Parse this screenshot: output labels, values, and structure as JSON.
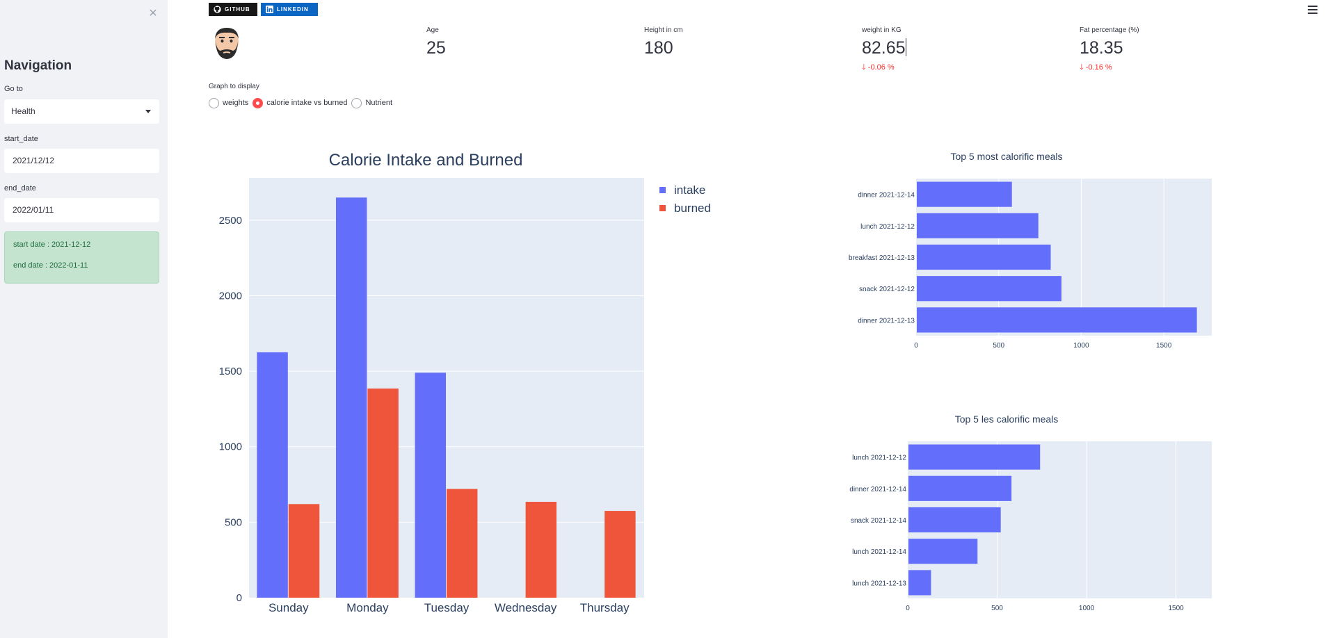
{
  "sidebar": {
    "close_icon": "close-icon",
    "title": "Navigation",
    "goto_label": "Go to",
    "goto_value": "Health",
    "start_label": "start_date",
    "start_value": "2021/12/12",
    "end_label": "end_date",
    "end_value": "2022/01/11",
    "info_start": "start date : 2021-12-12",
    "info_end": "end date : 2022-01-11"
  },
  "badges": {
    "github": "GITHUB",
    "linkedin": "LINKEDIN",
    "github_color": "#181717",
    "linkedin_color": "#0a66c2"
  },
  "metrics": [
    {
      "label": "Age",
      "value": "25",
      "delta": ""
    },
    {
      "label": "Height in cm",
      "value": "180",
      "delta": ""
    },
    {
      "label": "weight in KG",
      "value": "82.65",
      "delta": "-0.06 %"
    },
    {
      "label": "Fat percentage (%)",
      "value": "18.35",
      "delta": "-0.16 %"
    }
  ],
  "graph_select": {
    "label": "Graph to display",
    "options": [
      "weights",
      "calorie intake vs burned",
      "Nutrient"
    ],
    "selected": "calorie intake vs burned"
  },
  "colors": {
    "intake": "#636efa",
    "burned": "#ef553b",
    "plot_bg": "#e5ecf6",
    "accent": "#ff4b4b"
  },
  "chart_data": [
    {
      "type": "bar",
      "title": "Calorie Intake and Burned",
      "categories": [
        "Sunday",
        "Monday",
        "Tuesday",
        "Wednesday",
        "Thursday"
      ],
      "series": [
        {
          "name": "intake",
          "values": [
            1625,
            2650,
            1490,
            0,
            0
          ]
        },
        {
          "name": "burned",
          "values": [
            620,
            1385,
            720,
            635,
            575
          ]
        }
      ],
      "ylim": [
        0,
        2780
      ],
      "yticks": [
        0,
        500,
        1000,
        1500,
        2000,
        2500
      ],
      "grid": true,
      "legend": "right"
    },
    {
      "type": "bar",
      "orientation": "horizontal",
      "title": "Top 5 most calorific meals",
      "categories": [
        "dinner 2021-12-14",
        "lunch 2021-12-12",
        "breakfast 2021-12-13",
        "snack 2021-12-12",
        "dinner 2021-12-13"
      ],
      "values": [
        580,
        740,
        815,
        880,
        1700
      ],
      "xlim": [
        0,
        1790
      ],
      "xticks": [
        0,
        500,
        1000,
        1500
      ],
      "grid": true
    },
    {
      "type": "bar",
      "orientation": "horizontal",
      "title": "Top 5 les calorific meals",
      "categories": [
        "lunch 2021-12-12",
        "dinner 2021-12-14",
        "snack 2021-12-14",
        "lunch 2021-12-14",
        "lunch 2021-12-13"
      ],
      "values": [
        740,
        580,
        520,
        390,
        130
      ],
      "xlim": [
        0,
        1700
      ],
      "xticks": [
        0,
        500,
        1000,
        1500
      ],
      "grid": true
    }
  ]
}
